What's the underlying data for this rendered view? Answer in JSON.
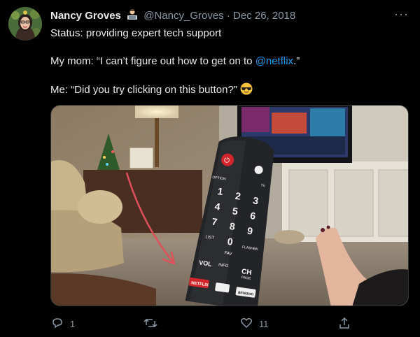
{
  "tweet": {
    "author_name": "Nancy Groves",
    "handle": "@Nancy_Groves",
    "separator": "·",
    "date": "Dec 26, 2018",
    "more_label": "···",
    "lines": {
      "line1": "Status: providing expert tech support",
      "line2_prefix": "My mom: “I can’t figure out how to get on to ",
      "line2_mention": "@netflix",
      "line2_suffix": ".”",
      "line3": "Me: “Did you try clicking on this button?” "
    },
    "badge_icon": "technologist-emoji",
    "emoji_icon": "sunglasses-emoji"
  },
  "remote": {
    "power": "⏻",
    "row_top": [
      "OPTION",
      "TV"
    ],
    "digits": [
      "1",
      "2",
      "3",
      "4",
      "5",
      "6",
      "7",
      "8",
      "9",
      "LIST",
      "0",
      "FLASHBK"
    ],
    "fav": "FAV",
    "vol": "VOL",
    "info": "INFO",
    "ch": "CH",
    "ch_sub": "PAGE",
    "netflix": "NETFLIX",
    "amazon": "amazon"
  },
  "actions": {
    "reply_count": "1",
    "retweet_count": "",
    "like_count": "11",
    "icons": [
      "reply-icon",
      "retweet-icon",
      "like-icon",
      "share-icon"
    ]
  },
  "colors": {
    "mention": "#1d9bf0",
    "muted": "#8b98a5",
    "arrow": "#e0505a",
    "netflix_red": "#d3252b"
  }
}
